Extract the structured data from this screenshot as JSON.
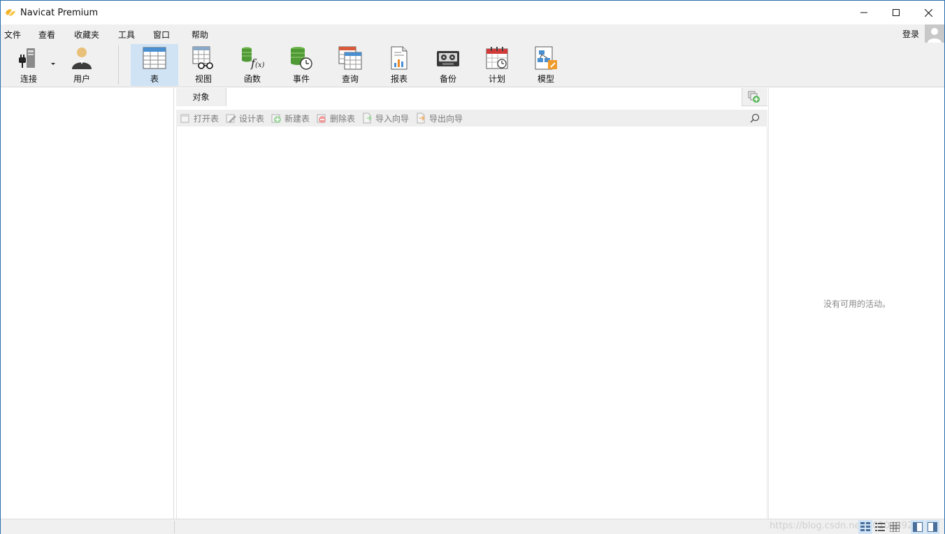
{
  "window": {
    "title": "Navicat Premium",
    "minimize_icon": "minimize-icon",
    "maximize_icon": "maximize-icon",
    "close_icon": "close-icon"
  },
  "menu": {
    "items": [
      "文件",
      "查看",
      "收藏夹",
      "工具",
      "窗口",
      "帮助"
    ],
    "login": "登录"
  },
  "toolbar": {
    "tools": [
      {
        "label": "连接",
        "icon": "plug-icon",
        "has_dropdown": true
      },
      {
        "label": "用户",
        "icon": "user-icon"
      },
      {
        "label": "表",
        "icon": "table-icon",
        "active": true
      },
      {
        "label": "视图",
        "icon": "view-glasses-icon"
      },
      {
        "label": "函数",
        "icon": "function-icon"
      },
      {
        "label": "事件",
        "icon": "event-clock-icon"
      },
      {
        "label": "查询",
        "icon": "query-icon"
      },
      {
        "label": "报表",
        "icon": "report-icon"
      },
      {
        "label": "备份",
        "icon": "backup-tape-icon"
      },
      {
        "label": "计划",
        "icon": "calendar-icon"
      },
      {
        "label": "模型",
        "icon": "model-icon"
      }
    ]
  },
  "objects": {
    "tab_label": "对象",
    "add_tab_icon": "add-tab-icon",
    "actions": [
      {
        "label": "打开表",
        "icon": "open-table-icon"
      },
      {
        "label": "设计表",
        "icon": "design-table-icon"
      },
      {
        "label": "新建表",
        "icon": "new-table-icon"
      },
      {
        "label": "删除表",
        "icon": "delete-table-icon"
      },
      {
        "label": "导入向导",
        "icon": "import-wizard-icon"
      },
      {
        "label": "导出向导",
        "icon": "export-wizard-icon"
      }
    ],
    "search_icon": "search-icon"
  },
  "info": {
    "empty_text": "没有可用的活动。"
  },
  "statusbar": {
    "watermark": "https://blog.csdn.net/u010489246"
  },
  "colors": {
    "active_tool_bg": "#cfe3f5",
    "window_border": "#2a6fb0",
    "toolbar_bg": "#f0f0f0"
  }
}
